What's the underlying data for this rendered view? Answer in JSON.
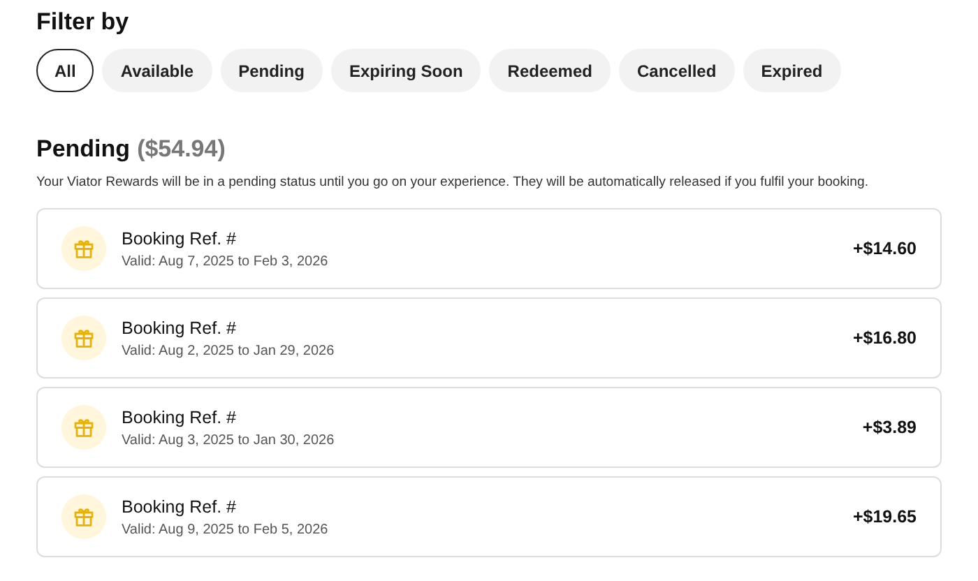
{
  "filter": {
    "title": "Filter by",
    "chips": [
      {
        "label": "All",
        "selected": true
      },
      {
        "label": "Available",
        "selected": false
      },
      {
        "label": "Pending",
        "selected": false
      },
      {
        "label": "Expiring Soon",
        "selected": false
      },
      {
        "label": "Redeemed",
        "selected": false
      },
      {
        "label": "Cancelled",
        "selected": false
      },
      {
        "label": "Expired",
        "selected": false
      }
    ]
  },
  "section": {
    "title": "Pending",
    "total": "($54.94)",
    "description": "Your Viator Rewards will be in a pending status until you go on your experience. They will be automatically released if you fulfil your booking."
  },
  "rewards": [
    {
      "title": "Booking Ref. #",
      "validity": "Valid: Aug 7, 2025 to Feb 3, 2026",
      "amount": "+$14.60"
    },
    {
      "title": "Booking Ref. #",
      "validity": "Valid: Aug 2, 2025 to Jan 29, 2026",
      "amount": "+$16.80"
    },
    {
      "title": "Booking Ref. #",
      "validity": "Valid: Aug 3, 2025 to Jan 30, 2026",
      "amount": "+$3.89"
    },
    {
      "title": "Booking Ref. #",
      "validity": "Valid: Aug 9, 2025 to Feb 5, 2026",
      "amount": "+$19.65"
    }
  ]
}
